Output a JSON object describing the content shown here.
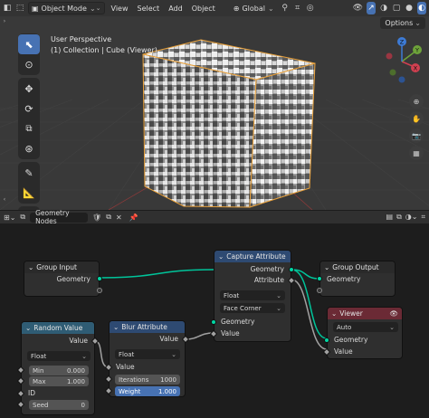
{
  "viewport": {
    "mode": "Object Mode",
    "menus": [
      "View",
      "Select",
      "Add",
      "Object"
    ],
    "transform_orientation": "Global",
    "options_label": "Options",
    "perspective": "User Perspective",
    "collection_info": "(1) Collection | Cube (Viewer)",
    "gizmo": {
      "x": "X",
      "y": "Y",
      "z": "Z"
    }
  },
  "node_editor": {
    "editor_name": "Geometry Nodes",
    "nodes": {
      "group_input": {
        "title": "Group Input",
        "geometry": "Geometry"
      },
      "capture": {
        "title": "Capture Attribute",
        "out_geometry": "Geometry",
        "out_attribute": "Attribute",
        "type": "Float",
        "domain": "Face Corner",
        "in_geometry": "Geometry",
        "in_value": "Value"
      },
      "group_output": {
        "title": "Group Output",
        "geometry": "Geometry"
      },
      "random": {
        "title": "Random Value",
        "out_value": "Value",
        "type": "Float",
        "min_label": "Min",
        "min_value": "0.000",
        "max_label": "Max",
        "max_value": "1.000",
        "id_label": "ID",
        "seed_label": "Seed",
        "seed_value": "0"
      },
      "blur": {
        "title": "Blur Attribute",
        "out_value": "Value",
        "type": "Float",
        "in_value": "Value",
        "iterations_label": "Iterations",
        "iterations_value": "1000",
        "weight_label": "Weight",
        "weight_value": "1.000"
      },
      "viewer": {
        "title": "Viewer",
        "domain": "Auto",
        "geometry": "Geometry",
        "value": "Value"
      }
    }
  },
  "colors": {
    "accent": "#4772b3",
    "geometry_socket": "#00d6a3",
    "float_socket": "#a1a1a1",
    "viewer_header": "#6b2a35"
  }
}
